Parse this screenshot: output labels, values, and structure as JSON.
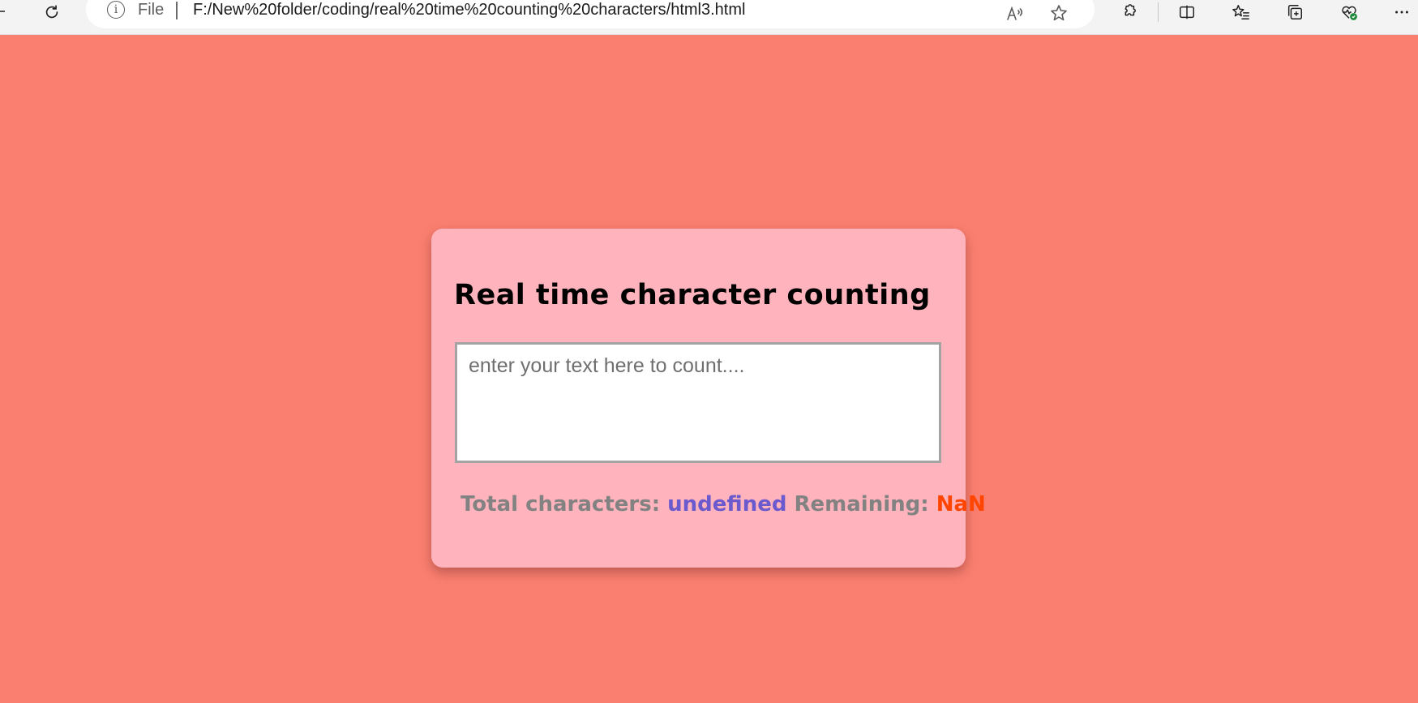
{
  "browser": {
    "address_prefix": "File",
    "url": "F:/New%20folder/coding/real%20time%20counting%20characters/html3.html",
    "icons": {
      "reload": "reload-icon",
      "info": "info-icon",
      "read_aloud": "read-aloud-icon",
      "favorite": "star-icon",
      "extensions": "extensions-icon",
      "split_screen": "split-screen-icon",
      "favorites": "favorites-icon",
      "collections": "collections-icon",
      "performance": "browser-essentials-icon",
      "more": "more-icon"
    }
  },
  "page": {
    "background_color": "#fa7f70",
    "card_color": "#ffb3bc",
    "title": "Real time character counting",
    "textarea": {
      "value": "",
      "placeholder": "enter your text here to count...."
    },
    "counter": {
      "total_label": "Total characters:",
      "total_value": "undefined",
      "remaining_label": "Remaining:",
      "remaining_value": "NaN",
      "total_value_color": "#6a5acd",
      "remaining_value_color": "#ff4500"
    }
  }
}
